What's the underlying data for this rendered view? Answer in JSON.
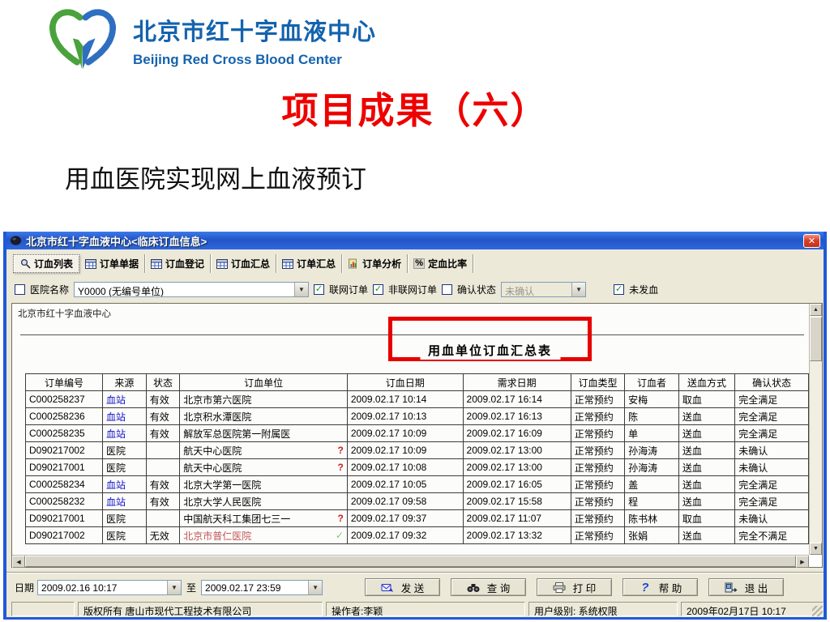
{
  "slide": {
    "logo": {
      "org_cn": "北京市红十字血液中心",
      "org_en": "Beijing Red Cross Blood Center"
    },
    "title": "项目成果（六）",
    "subtitle": "用血医院实现网上血液预订"
  },
  "window": {
    "title": "北京市红十字血液中心<临床订血信息>",
    "close_label": "✕",
    "tabs": [
      {
        "id": "order-list",
        "label": "订血列表",
        "icon": "magnifier-icon",
        "selected": true
      },
      {
        "id": "order-doc",
        "label": "订单单据",
        "icon": "grid-icon",
        "selected": false
      },
      {
        "id": "order-reg",
        "label": "订血登记",
        "icon": "grid-icon",
        "selected": false
      },
      {
        "id": "blood-summary",
        "label": "订血汇总",
        "icon": "grid-icon",
        "selected": false
      },
      {
        "id": "order-summary",
        "label": "订单汇总",
        "icon": "grid-icon",
        "selected": false
      },
      {
        "id": "analysis",
        "label": "订单分析",
        "icon": "analysis-icon",
        "selected": false
      },
      {
        "id": "ratio",
        "label": "定血比率",
        "icon": "percent-icon",
        "selected": false
      }
    ],
    "filters": {
      "hospital_checkbox": {
        "label": "医院名称",
        "checked": false
      },
      "hospital_select": "Y0000 (无编号单位)",
      "online_orders": {
        "label": "联网订单",
        "checked": true
      },
      "offline_orders": {
        "label": "非联网订单",
        "checked": true
      },
      "confirm_state": {
        "label": "确认状态",
        "checked": false
      },
      "confirm_select": "未确认",
      "not_sent": {
        "label": "未发血",
        "checked": true
      }
    },
    "report": {
      "org_line": "北京市红十字血液中心",
      "title": "用血单位订血汇总表",
      "columns": [
        "订单编号",
        "来源",
        "状态",
        "订血单位",
        "订血日期",
        "需求日期",
        "订血类型",
        "订血者",
        "送血方式",
        "确认状态"
      ],
      "rows": [
        {
          "cells": [
            "C000258237",
            "血站",
            "有效",
            "北京市第六医院",
            "2009.02.17 10:14",
            "2009.02.17 16:14",
            "正常预约",
            "安梅",
            "取血",
            "完全满足"
          ],
          "mark": "",
          "red_cells": []
        },
        {
          "cells": [
            "C000258236",
            "血站",
            "有效",
            "北京积水潭医院",
            "2009.02.17 10:13",
            "2009.02.17 16:13",
            "正常预约",
            "陈",
            "送血",
            "完全满足"
          ],
          "mark": "",
          "red_cells": []
        },
        {
          "cells": [
            "C000258235",
            "血站",
            "有效",
            "解放军总医院第一附属医",
            "2009.02.17 10:09",
            "2009.02.17 16:09",
            "正常预约",
            "单",
            "送血",
            "完全满足"
          ],
          "mark": "",
          "red_cells": []
        },
        {
          "cells": [
            "D090217002",
            "医院",
            "",
            "航天中心医院",
            "2009.02.17 10:09",
            "2009.02.17 13:00",
            "正常预约",
            "孙海涛",
            "送血",
            "未确认"
          ],
          "mark": "?",
          "red_cells": []
        },
        {
          "cells": [
            "D090217001",
            "医院",
            "",
            "航天中心医院",
            "2009.02.17 10:08",
            "2009.02.17 13:00",
            "正常预约",
            "孙海涛",
            "送血",
            "未确认"
          ],
          "mark": "?",
          "red_cells": []
        },
        {
          "cells": [
            "C000258234",
            "血站",
            "有效",
            "北京大学第一医院",
            "2009.02.17 10:05",
            "2009.02.17 16:05",
            "正常预约",
            "盖",
            "送血",
            "完全满足"
          ],
          "mark": "",
          "red_cells": []
        },
        {
          "cells": [
            "C000258232",
            "血站",
            "有效",
            "北京大学人民医院",
            "2009.02.17 09:58",
            "2009.02.17 15:58",
            "正常预约",
            "程",
            "送血",
            "完全满足"
          ],
          "mark": "",
          "red_cells": []
        },
        {
          "cells": [
            "D090217001",
            "医院",
            "",
            "中国航天科工集团七三一",
            "2009.02.17 09:37",
            "2009.02.17 11:07",
            "正常预约",
            "陈书林",
            "取血",
            "未确认"
          ],
          "mark": "?",
          "red_cells": []
        },
        {
          "cells": [
            "D090217002",
            "医院",
            "无效",
            "北京市普仁医院",
            "2009.02.17 09:32",
            "2009.02.17 13:32",
            "正常预约",
            "张娟",
            "送血",
            "完全不满足"
          ],
          "mark": "✓",
          "red_cells": [
            0,
            2,
            3,
            4,
            5,
            6,
            7
          ]
        }
      ]
    },
    "footer": {
      "date_label": "日期",
      "date_from": "2009.02.16 10:17",
      "to_label": "至",
      "date_to": "2009.02.17 23:59",
      "buttons": [
        {
          "id": "send",
          "label": "发  送",
          "icon": "send-icon"
        },
        {
          "id": "query",
          "label": "查  询",
          "icon": "binoculars-icon"
        },
        {
          "id": "print",
          "label": "打  印",
          "icon": "printer-icon"
        },
        {
          "id": "help",
          "label": "帮  助",
          "icon": "help-icon"
        },
        {
          "id": "exit",
          "label": "退  出",
          "icon": "exit-icon"
        }
      ]
    },
    "statusbar": {
      "copyright": "版权所有  唐山市现代工程技术有限公司",
      "operator": "操作者:李颖",
      "user_level": "用户级别: 系统权限",
      "datetime": "2009年02月17日  10:17"
    }
  },
  "colors": {
    "accent_red": "#ee0000",
    "annotation_red": "#e60000",
    "logo_blue": "#1463ae",
    "source_blue": "#1111cc",
    "invalid_row_red": "#c25555",
    "titlebar_blue": "#2256c8"
  }
}
